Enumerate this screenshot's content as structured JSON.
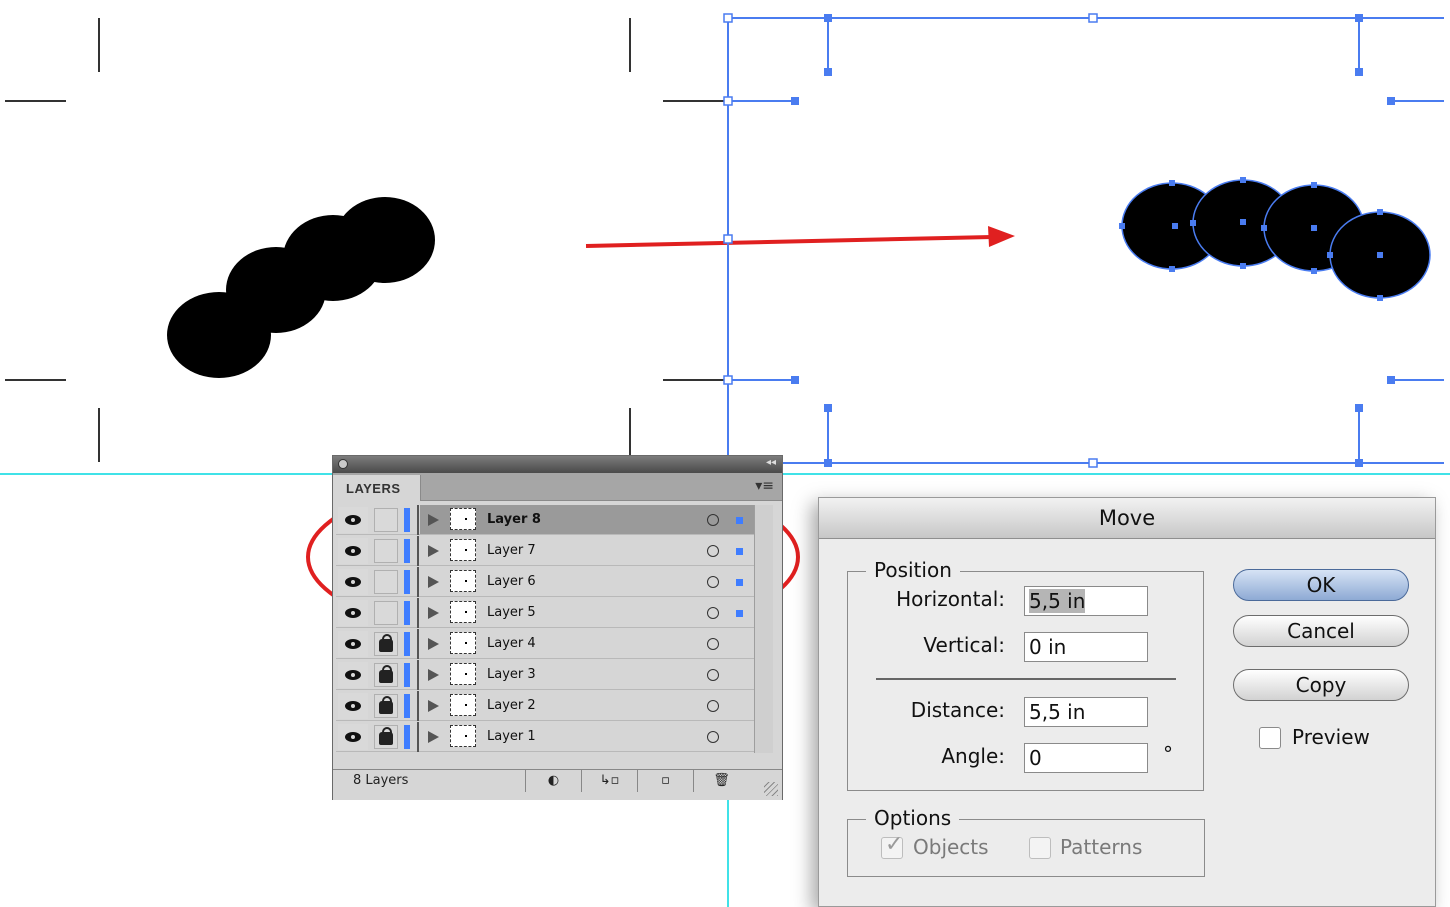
{
  "colors": {
    "guide_cyan": "#00d8e0",
    "selection_blue": "#3f7dff",
    "annotation_red": "#e02020",
    "shape_fill": "#000000"
  },
  "layers_panel": {
    "tab_label": "LAYERS",
    "menu_icon": "panel-menu-icon",
    "layers": [
      {
        "name": "Layer 8",
        "visible": true,
        "locked": false,
        "selected": true,
        "has_selection": true
      },
      {
        "name": "Layer 7",
        "visible": true,
        "locked": false,
        "selected": false,
        "has_selection": true
      },
      {
        "name": "Layer 6",
        "visible": true,
        "locked": false,
        "selected": false,
        "has_selection": true
      },
      {
        "name": "Layer 5",
        "visible": true,
        "locked": false,
        "selected": false,
        "has_selection": true
      },
      {
        "name": "Layer 4",
        "visible": true,
        "locked": true,
        "selected": false,
        "has_selection": false
      },
      {
        "name": "Layer 3",
        "visible": true,
        "locked": true,
        "selected": false,
        "has_selection": false
      },
      {
        "name": "Layer 2",
        "visible": true,
        "locked": true,
        "selected": false,
        "has_selection": false
      },
      {
        "name": "Layer 1",
        "visible": true,
        "locked": true,
        "selected": false,
        "has_selection": false
      }
    ],
    "footer": {
      "count_text": "8 Layers",
      "buttons": [
        "make-clipping-mask-icon",
        "create-sublayer-icon",
        "new-layer-icon",
        "trash-icon"
      ]
    }
  },
  "move_dialog": {
    "title": "Move",
    "position_group_label": "Position",
    "horizontal_label": "Horizontal:",
    "horizontal_value": "5,5 in",
    "vertical_label": "Vertical:",
    "vertical_value": "0 in",
    "distance_label": "Distance:",
    "distance_value": "5,5 in",
    "angle_label": "Angle:",
    "angle_value": "0",
    "degree_symbol": "°",
    "options_group_label": "Options",
    "objects_label": "Objects",
    "objects_checked": true,
    "patterns_label": "Patterns",
    "patterns_checked": false,
    "ok_label": "OK",
    "cancel_label": "Cancel",
    "copy_label": "Copy",
    "preview_label": "Preview",
    "preview_checked": false
  }
}
